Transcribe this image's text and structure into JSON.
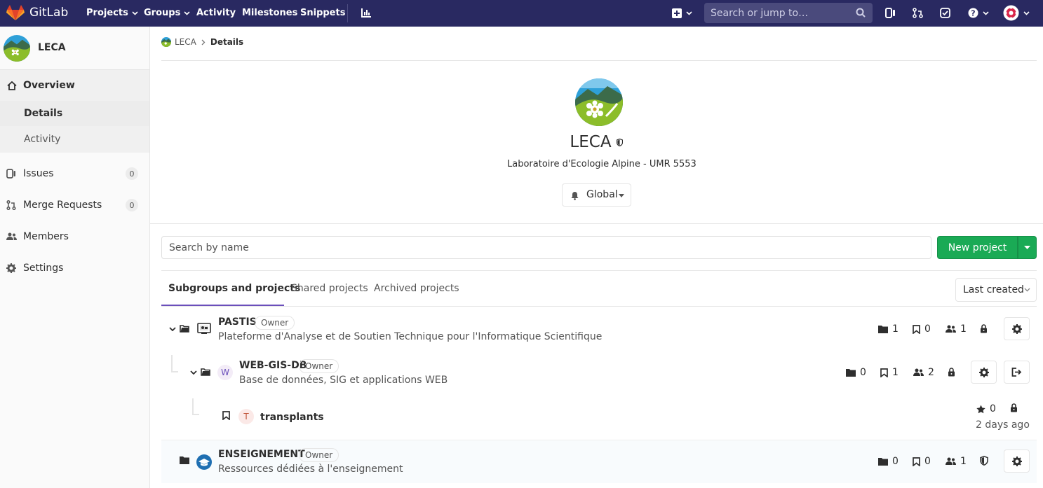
{
  "topnav": {
    "brand": "GitLab",
    "links": [
      "Projects",
      "Groups",
      "Activity",
      "Milestones",
      "Snippets"
    ],
    "search_placeholder": "Search or jump to…",
    "brand_color": "#292961"
  },
  "sidebar": {
    "group_name": "LECA",
    "items": [
      {
        "label": "Overview",
        "icon": "home-icon"
      },
      {
        "label": "Details"
      },
      {
        "label": "Activity"
      },
      {
        "label": "Issues",
        "count": "0",
        "icon": "issues-icon"
      },
      {
        "label": "Merge Requests",
        "count": "0",
        "icon": "merge-request-icon"
      },
      {
        "label": "Members",
        "icon": "users-icon"
      },
      {
        "label": "Settings",
        "icon": "gear-icon"
      }
    ]
  },
  "breadcrumb": {
    "group": "LECA",
    "current": "Details"
  },
  "group": {
    "name": "LECA",
    "description": "Laboratoire d'Ecologie Alpine - UMR 5553",
    "notification": "Global"
  },
  "search": {
    "placeholder": "Search by name"
  },
  "new_project": {
    "label": "New project",
    "color": "#1aaa55"
  },
  "tabs": [
    "Subgroups and projects",
    "Shared projects",
    "Archived projects"
  ],
  "sort": {
    "label": "Last created"
  },
  "rows": [
    {
      "name": "PASTIS",
      "role": "Owner",
      "description": "Plateforme d'Analyse et de Soutien Technique pour l'Informatique Scientifique",
      "subgroups": "1",
      "projects": "0",
      "members": "1"
    },
    {
      "name": "WEB-GIS-DB",
      "role": "Owner",
      "avatar_letter": "W",
      "description": "Base de données, SIG et applications WEB",
      "subgroups": "0",
      "projects": "1",
      "members": "2"
    },
    {
      "name": "transplants",
      "avatar_letter": "T",
      "stars": "0",
      "updated": "2 days ago"
    },
    {
      "name": "ENSEIGNEMENT",
      "role": "Owner",
      "description": "Ressources dédiées à l'enseignement",
      "subgroups": "0",
      "projects": "0",
      "members": "1"
    }
  ]
}
